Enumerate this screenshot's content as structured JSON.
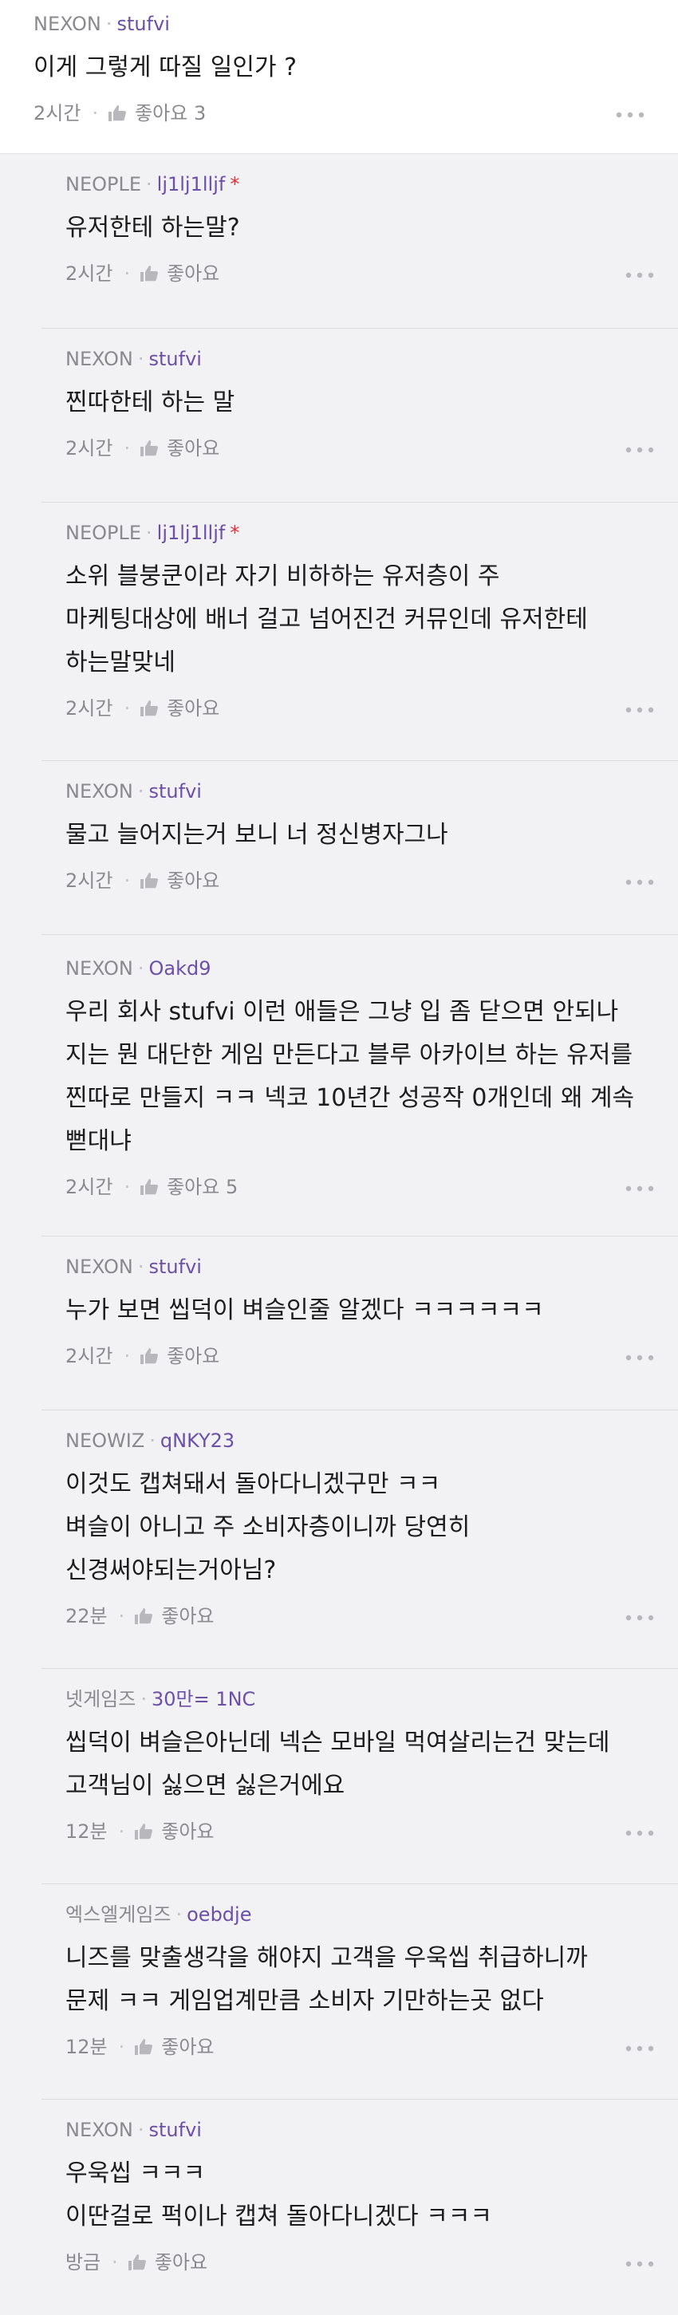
{
  "top_comment": {
    "company": "NEXON",
    "nickname": "stufvi",
    "text": [
      "이게 그렇게 따질 일인가 ?"
    ],
    "time": "2시간",
    "like_label": "좋아요",
    "like_count": "3"
  },
  "replies": [
    {
      "company": "NEOPLE",
      "nickname": "lj1lj1lljf",
      "star": "*",
      "text": [
        "유저한테 하는말?"
      ],
      "time": "2시간",
      "like_label": "좋아요",
      "like_count": ""
    },
    {
      "company": "NEXON",
      "nickname": "stufvi",
      "star": "",
      "text": [
        "찐따한테 하는 말"
      ],
      "time": "2시간",
      "like_label": "좋아요",
      "like_count": ""
    },
    {
      "company": "NEOPLE",
      "nickname": "lj1lj1lljf",
      "star": "*",
      "text": [
        "소위 블붕쿤이라 자기 비하하는 유저층이 주",
        "마케팅대상에 배너 걸고 넘어진건 커뮤인데 유저한테",
        "하는말맞네"
      ],
      "time": "2시간",
      "like_label": "좋아요",
      "like_count": ""
    },
    {
      "company": "NEXON",
      "nickname": "stufvi",
      "star": "",
      "text": [
        "물고 늘어지는거 보니 너 정신병자그나"
      ],
      "time": "2시간",
      "like_label": "좋아요",
      "like_count": ""
    },
    {
      "company": "NEXON",
      "nickname": "Oakd9",
      "star": "",
      "text": [
        "우리 회사 stufvi 이런 애들은 그냥 입 좀 닫으면 안되나",
        "지는 뭔 대단한 게임 만든다고 블루 아카이브 하는 유저를",
        "찐따로 만들지 ㅋㅋ 넥코 10년간 성공작 0개인데 왜 계속",
        "뻗대냐"
      ],
      "time": "2시간",
      "like_label": "좋아요",
      "like_count": "5"
    },
    {
      "company": "NEXON",
      "nickname": "stufvi",
      "star": "",
      "text": [
        "누가 보면 씹덕이 벼슬인줄 알겠다 ㅋㅋㅋㅋㅋㅋ"
      ],
      "time": "2시간",
      "like_label": "좋아요",
      "like_count": ""
    },
    {
      "company": "NEOWIZ",
      "nickname": "qNKY23",
      "star": "",
      "text": [
        "이것도 캡쳐돼서 돌아다니겠구만 ㅋㅋ",
        "벼슬이 아니고 주 소비자층이니까 당연히",
        "신경써야되는거아님?"
      ],
      "time": "22분",
      "like_label": "좋아요",
      "like_count": ""
    },
    {
      "company": "넷게임즈",
      "nickname": "30만= 1NC",
      "star": "",
      "text": [
        "씹덕이 벼슬은아닌데 넥슨 모바일 먹여살리는건 맞는데",
        "고객님이 싫으면 싫은거에요"
      ],
      "time": "12분",
      "like_label": "좋아요",
      "like_count": ""
    },
    {
      "company": "엑스엘게임즈",
      "nickname": "oebdje",
      "star": "",
      "text": [
        "니즈를 맞출생각을 해야지 고객을 우욱씹 취급하니까",
        "문제 ㅋㅋ  게임업계만큼 소비자 기만하는곳 없다"
      ],
      "time": "12분",
      "like_label": "좋아요",
      "like_count": ""
    },
    {
      "company": "NEXON",
      "nickname": "stufvi",
      "star": "",
      "text": [
        "우욱씹 ㅋㅋㅋ",
        "이딴걸로 퍽이나 캡쳐 돌아다니겠다 ㅋㅋㅋ"
      ],
      "time": "방금",
      "like_label": "좋아요",
      "like_count": ""
    }
  ],
  "colors": {
    "nickname": "#6b4fa8",
    "star": "#e0303a",
    "meta": "#8a8a8e",
    "reply_bg": "#f2f2f4",
    "top_bg": "#ffffff"
  },
  "icons": {
    "like": "thumbs-up-icon",
    "more": "more-horizontal-icon"
  }
}
